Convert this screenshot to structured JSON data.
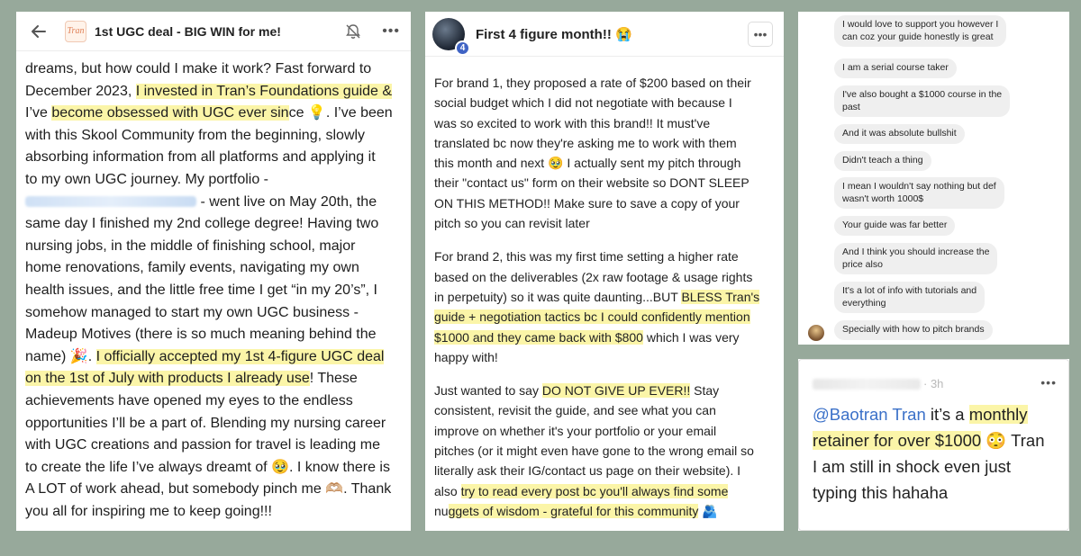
{
  "card1": {
    "title": "1st UGC deal - BIG WIN for me!",
    "logo_text": "Tran",
    "lines": [
      [
        {
          "t": "dreams, but how could I make it work? Fast forward to"
        }
      ],
      [
        {
          "t": "December 2023, "
        },
        {
          "t": "I invested in Tran’s Foundations guide &",
          "hl": true
        }
      ],
      [
        {
          "t": "I’ve "
        },
        {
          "t": "become obsessed with UGC ever sin",
          "hl": true
        },
        {
          "t": "ce 💡. I’ve been"
        }
      ],
      [
        {
          "t": "with this Skool Community from the beginning, slowly"
        }
      ],
      [
        {
          "t": "absorbing information from all platforms and applying it"
        }
      ],
      [
        {
          "t": "to my own UGC journey. My portfolio -"
        }
      ],
      [
        {
          "t": "",
          "blur": true
        },
        {
          "t": " - went live on May 20th, the"
        }
      ],
      [
        {
          "t": "same day I finished my 2nd college degree! Having two"
        }
      ],
      [
        {
          "t": "nursing jobs, in the middle of finishing school, major"
        }
      ],
      [
        {
          "t": "home renovations, family events, navigating my own"
        }
      ],
      [
        {
          "t": "health issues, and the little free time I get “in my 20’s”, I"
        }
      ],
      [
        {
          "t": "somehow managed to start my own UGC business -"
        }
      ],
      [
        {
          "t": "Madeup Motives (there is so much meaning behind the"
        }
      ],
      [
        {
          "t": "name) 🎉. "
        },
        {
          "t": "I officially accepted my 1st 4-figure UGC deal",
          "hl": true
        }
      ],
      [
        {
          "t": "on the 1st of July with products I already use",
          "hl": true
        },
        {
          "t": "! These"
        }
      ],
      [
        {
          "t": "achievements have opened my eyes to the endless"
        }
      ],
      [
        {
          "t": "opportunities I’ll be a part of. Blending my nursing career"
        }
      ],
      [
        {
          "t": "with UGC creations and passion for travel is leading me"
        }
      ],
      [
        {
          "t": "to create the life I’ve always dreamt of 🥹. I know there is"
        }
      ],
      [
        {
          "t": "A LOT of work ahead, but somebody pinch me 🫶🏼. Thank"
        }
      ],
      [
        {
          "t": "you all for inspiring me to keep going!!!"
        }
      ]
    ]
  },
  "card2": {
    "title": "First 4 figure month!! 😭",
    "badge": "4",
    "paragraphs": [
      [
        [
          {
            "t": "For brand 1, they proposed a rate of $200 based on their"
          }
        ],
        [
          {
            "t": "social budget which I did not negotiate with because I"
          }
        ],
        [
          {
            "t": "was so excited to work with this brand!! It must've"
          }
        ],
        [
          {
            "t": "translated bc now they're asking me to work with them"
          }
        ],
        [
          {
            "t": "this month and next 🥹 I actually sent my pitch through"
          }
        ],
        [
          {
            "t": "their \"contact us\" form on their website so DONT SLEEP"
          }
        ],
        [
          {
            "t": "ON THIS METHOD!! Make sure to save a copy of your"
          }
        ],
        [
          {
            "t": "pitch so you can revisit later"
          }
        ]
      ],
      [
        [
          {
            "t": "For brand 2, this was my first time setting a higher rate"
          }
        ],
        [
          {
            "t": "based on the deliverables (2x raw footage & usage rights"
          }
        ],
        [
          {
            "t": "in perpetuity) so it was quite daunting...BUT "
          },
          {
            "t": "BLESS Tran's",
            "hl": true
          }
        ],
        [
          {
            "t": "guide + negotiation tactics bc I could confidently mention",
            "hl": true
          }
        ],
        [
          {
            "t": "$1000 and they came back with $800",
            "hl": true
          },
          {
            "t": " which I was very"
          }
        ],
        [
          {
            "t": "happy with!"
          }
        ]
      ],
      [
        [
          {
            "t": "Just wanted to say "
          },
          {
            "t": "DO NOT GIVE UP EVER!!",
            "hl": true
          },
          {
            "t": " Stay"
          }
        ],
        [
          {
            "t": "consistent, revisit the guide, and see what you can"
          }
        ],
        [
          {
            "t": "improve on whether it's your portfolio or your email"
          }
        ],
        [
          {
            "t": "pitches (or it might even have gone to the wrong email so"
          }
        ],
        [
          {
            "t": "literally ask their IG/contact us page on their website). I"
          }
        ],
        [
          {
            "t": "also "
          },
          {
            "t": "try to read every post bc you'll always find some",
            "hl": true
          }
        ],
        [
          {
            "t": "nu"
          },
          {
            "t": "ggets of wisdom - grateful for this community",
            "hl": true
          },
          {
            "t": " 🫂"
          }
        ]
      ]
    ]
  },
  "chat": {
    "messages": [
      {
        "lines": [
          "I would love to support you however I",
          "can coz your guide honestly is great"
        ]
      },
      {
        "lines": [
          "I am a serial course taker"
        ]
      },
      {
        "lines": [
          "I've also bought a $1000 course in the",
          "past"
        ]
      },
      {
        "lines": [
          "And it was absolute bullshit"
        ]
      },
      {
        "lines": [
          "Didn't teach a thing"
        ]
      },
      {
        "lines": [
          "I mean I wouldn't say nothing but def",
          "wasn't worth 1000$"
        ]
      },
      {
        "lines": [
          "Your guide was far better"
        ]
      },
      {
        "lines": [
          "And I think you should increase the",
          "price also"
        ]
      },
      {
        "lines": [
          "It's a lot of info with tutorials and",
          "everything"
        ]
      },
      {
        "lines": [
          "Specially with how to pitch brands"
        ]
      }
    ]
  },
  "card4": {
    "time": "· 3h",
    "lines": [
      [
        {
          "t": "@Baotran Tran",
          "mention": true
        },
        {
          "t": " it’s a "
        },
        {
          "t": "monthly",
          "hl": true
        }
      ],
      [
        {
          "t": "retainer for over $1000",
          "hl": true
        },
        {
          "t": " 😳 Tran"
        }
      ],
      [
        {
          "t": "I am still in shock even just"
        }
      ],
      [
        {
          "t": "typing this hahaha"
        }
      ]
    ]
  }
}
